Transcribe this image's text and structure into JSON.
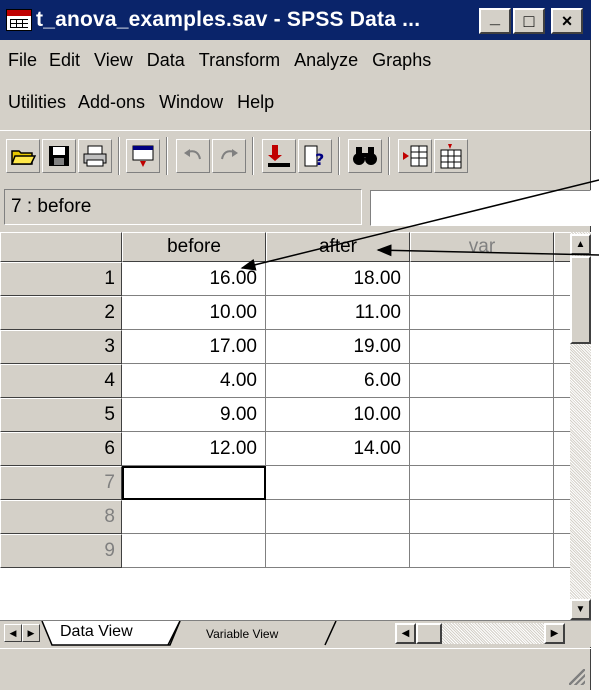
{
  "window": {
    "title": "t_anova_examples.sav - SPSS Data ...",
    "min_glyph": "_",
    "max_glyph": "□",
    "close_glyph": "×"
  },
  "menu": {
    "items": [
      "File",
      "Edit",
      "View",
      "Data",
      "Transform",
      "Analyze",
      "Graphs",
      "Utilities",
      "Add-ons",
      "Window",
      "Help"
    ]
  },
  "toolbar": {
    "icons": [
      "open-folder-icon",
      "save-disk-icon",
      "print-icon",
      "dialog-recall-icon",
      "undo-icon",
      "redo-icon",
      "goto-case-icon",
      "variables-info-icon",
      "find-binoculars-icon",
      "insert-cases-icon",
      "insert-variable-icon"
    ]
  },
  "cell_editor": {
    "reference": "7 : before",
    "value": ""
  },
  "grid": {
    "columns": [
      "before",
      "after",
      "var"
    ],
    "row_numbers": [
      "1",
      "2",
      "3",
      "4",
      "5",
      "6",
      "7",
      "8",
      "9"
    ],
    "rows": [
      [
        "16.00",
        "18.00",
        ""
      ],
      [
        "10.00",
        "11.00",
        ""
      ],
      [
        "17.00",
        "19.00",
        ""
      ],
      [
        "4.00",
        "6.00",
        ""
      ],
      [
        "9.00",
        "10.00",
        ""
      ],
      [
        "12.00",
        "14.00",
        ""
      ],
      [
        "",
        "",
        ""
      ],
      [
        "",
        "",
        ""
      ],
      [
        "",
        "",
        ""
      ]
    ],
    "active_cell": "7 : before"
  },
  "tabs": {
    "data_view": "Data View",
    "variable_view": "Variable View"
  },
  "colors": {
    "titlebar": "#0a246a",
    "face": "#d4d0c8",
    "dim_text": "#808080"
  }
}
